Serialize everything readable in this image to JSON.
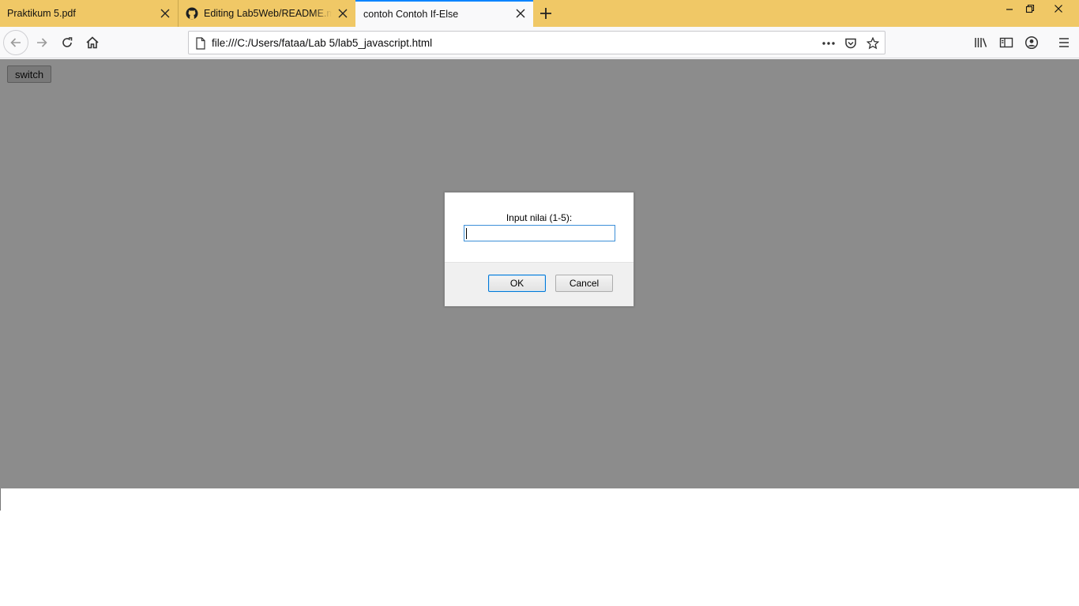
{
  "browser": {
    "tabs": [
      {
        "title": "Praktikum 5.pdf",
        "icon": "none",
        "active": false
      },
      {
        "title": "Editing Lab5Web/README.md",
        "icon": "github-icon",
        "active": false
      },
      {
        "title": "contoh Contoh If-Else",
        "icon": "none",
        "active": true
      }
    ],
    "url": "file:///C:/Users/fataa/Lab 5/lab5_javascript.html",
    "accent_color": "#0a84ff",
    "tabbar_color": "#f0c866"
  },
  "page": {
    "switch_label": "switch"
  },
  "dialog": {
    "label": "Input nilai (1-5):",
    "input_value": "",
    "ok_label": "OK",
    "cancel_label": "Cancel"
  }
}
